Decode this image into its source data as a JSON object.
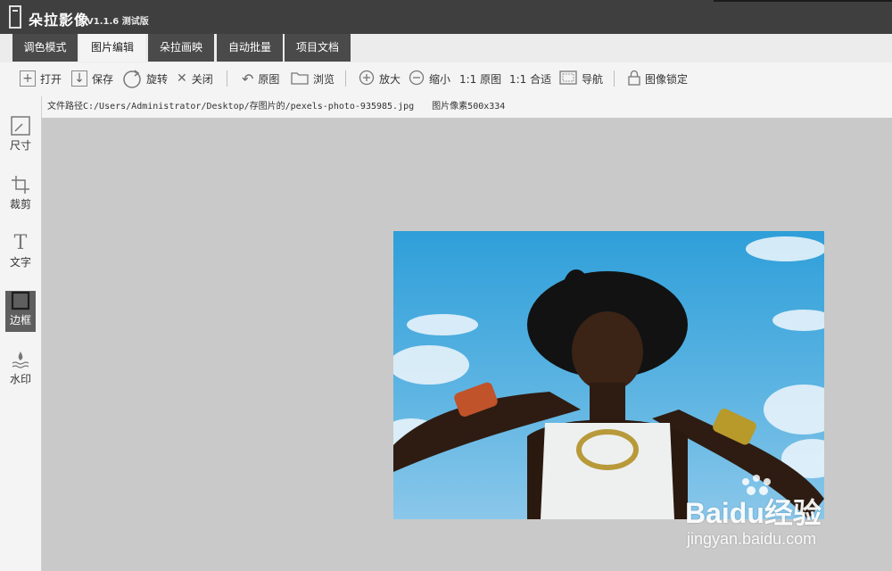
{
  "app": {
    "title": "朵拉影像",
    "version": "V1.1.6 测试版"
  },
  "tabs": [
    {
      "label": "调色模式"
    },
    {
      "label": "图片编辑"
    },
    {
      "label": "朵拉画映"
    },
    {
      "label": "自动批量"
    },
    {
      "label": "项目文档"
    }
  ],
  "toolbar": {
    "open": "打开",
    "save": "保存",
    "rotate": "旋转",
    "close": "关闭",
    "original": "原图",
    "browse": "浏览",
    "zoom_in": "放大",
    "zoom_out": "缩小",
    "actual_size": "1:1 原图",
    "fit": "1:1 合适",
    "navigate": "导航",
    "lock": "图像锁定"
  },
  "info": {
    "path": "文件路径C:/Users/Administrator/Desktop/存图片的/pexels-photo-935985.jpg",
    "pixels": "图片像素500x334"
  },
  "sidebar": [
    {
      "label": "尺寸",
      "icon": "resize-icon"
    },
    {
      "label": "裁剪",
      "icon": "crop-icon"
    },
    {
      "label": "文字",
      "icon": "text-icon"
    },
    {
      "label": "边框",
      "icon": "border-icon",
      "active": true
    },
    {
      "label": "水印",
      "icon": "watermark-icon"
    }
  ],
  "watermark": {
    "logo": "Baidu经验",
    "url": "jingyan.baidu.com"
  },
  "colors": {
    "titlebar": "#3f3f3f",
    "tab_bg": "#4a4a4a",
    "panel": "#f4f4f4",
    "canvas": "#c9c9c9",
    "active_tool": "#5f5f5f"
  }
}
